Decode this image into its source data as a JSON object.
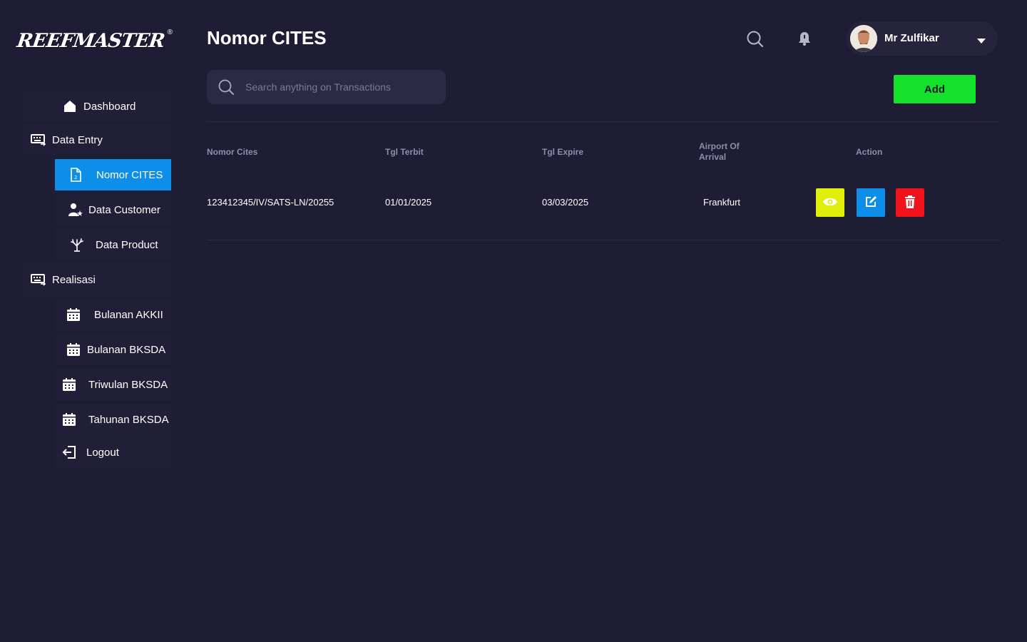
{
  "brand": {
    "name": "REEFMASTER",
    "registered": "®"
  },
  "sidebar": {
    "items": [
      {
        "label": "Dashboard",
        "icon": "home-icon"
      },
      {
        "label": "Data Entry",
        "icon": "keyboard-icon"
      },
      {
        "label": "Nomor CITES",
        "icon": "document-icon",
        "active": true
      },
      {
        "label": "Data Customer",
        "icon": "user-star-icon"
      },
      {
        "label": "Data Product",
        "icon": "coral-icon"
      },
      {
        "label": "Realisasi",
        "icon": "keyboard-icon"
      },
      {
        "label": "Bulanan AKKII",
        "icon": "calendar-icon"
      },
      {
        "label": "Bulanan BKSDA",
        "icon": "calendar-icon"
      },
      {
        "label": "Triwulan BKSDA",
        "icon": "calendar-icon"
      },
      {
        "label": "Tahunan BKSDA",
        "icon": "calendar-icon"
      },
      {
        "label": "Logout",
        "icon": "logout-icon"
      }
    ]
  },
  "header": {
    "title": "Nomor CITES",
    "user_name": "Mr Zulfikar"
  },
  "toolbar": {
    "search_placeholder": "Search anything on Transactions",
    "add_label": "Add"
  },
  "table": {
    "columns": [
      "Nomor Cites",
      "Tgl Terbit",
      "Tgl Expire",
      "Airport Of\nArrival",
      "Action"
    ],
    "rows": [
      {
        "nomor_cites": "123412345/IV/SATS-LN/20255",
        "tgl_terbit": "01/01/2025",
        "tgl_expire": "03/03/2025",
        "airport": "Frankfurt"
      }
    ],
    "actions": [
      "view",
      "edit",
      "delete"
    ]
  },
  "colors": {
    "background": "#1f1d35",
    "active_nav": "#0d8ee9",
    "add_button": "#13e12c",
    "view_button": "#e1ef08",
    "edit_button": "#0d8ee9",
    "delete_button": "#f0131b"
  }
}
